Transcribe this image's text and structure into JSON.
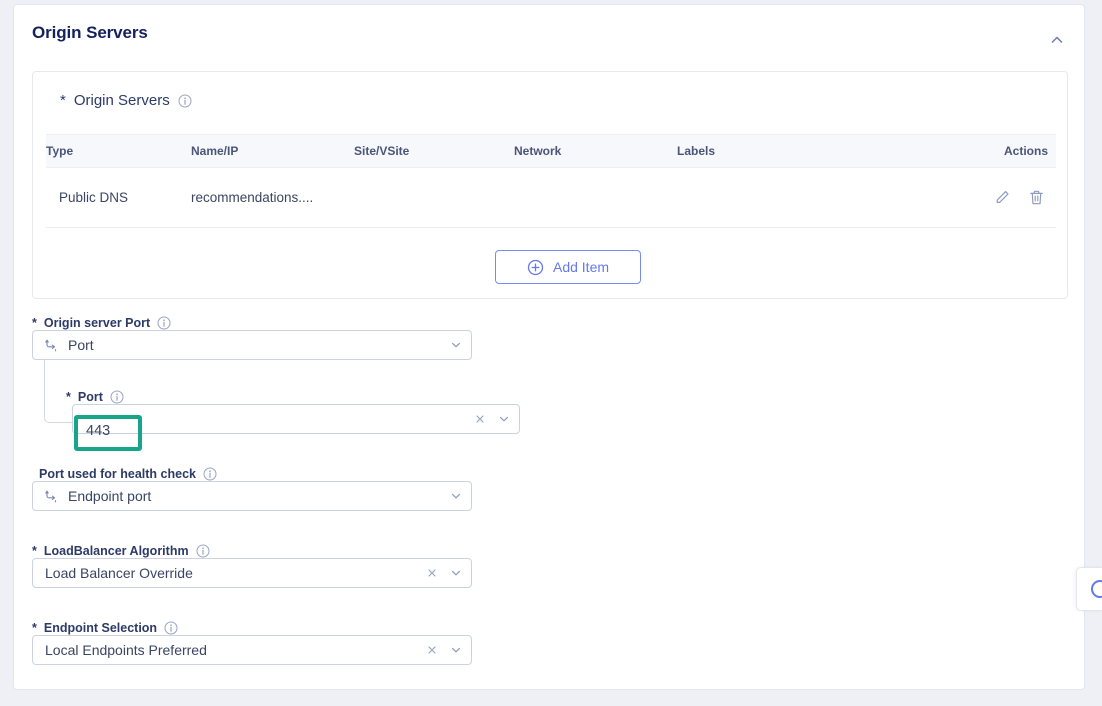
{
  "panel": {
    "title": "Origin Servers",
    "collapse_icon": "chevron-up-icon"
  },
  "origin_servers_section": {
    "label": "Origin Servers",
    "required_marker": "*",
    "info_icon": "info-icon",
    "table": {
      "columns": [
        "Type",
        "Name/IP",
        "Site/VSite",
        "Network",
        "Labels",
        "Actions"
      ],
      "rows": [
        {
          "type": "Public DNS",
          "name_ip": "recommendations....",
          "site_vsite": "",
          "network": "",
          "labels": "",
          "edit_icon": "pencil-icon",
          "delete_icon": "trash-icon"
        }
      ]
    },
    "add_item_button": {
      "label": "Add Item",
      "icon": "plus-circle-icon"
    }
  },
  "fields": {
    "origin_server_port": {
      "label": "Origin server Port",
      "required_marker": "*",
      "value": "Port",
      "lead_icon": "branch-icon",
      "chevron_icon": "chevron-down-icon"
    },
    "port": {
      "label": "Port",
      "required_marker": "*",
      "value": "443",
      "clear_icon": "close-icon",
      "chevron_icon": "chevron-down-icon",
      "highlight_color": "#17a589"
    },
    "health_check_port": {
      "label": "Port used for health check",
      "required_marker": "",
      "value": "Endpoint port",
      "lead_icon": "branch-icon",
      "chevron_icon": "chevron-down-icon"
    },
    "loadbalancer_algorithm": {
      "label": "LoadBalancer Algorithm",
      "required_marker": "*",
      "value": "Load Balancer Override",
      "clear_icon": "close-icon",
      "chevron_icon": "chevron-down-icon"
    },
    "endpoint_selection": {
      "label": "Endpoint Selection",
      "required_marker": "*",
      "value": "Local Endpoints Preferred",
      "clear_icon": "close-icon",
      "chevron_icon": "chevron-down-icon"
    }
  },
  "float_widget": {
    "icon": "help-circle-icon"
  },
  "colors": {
    "accent_blue": "#6478ec",
    "title_navy": "#14215c",
    "highlight_teal": "#17a589"
  }
}
